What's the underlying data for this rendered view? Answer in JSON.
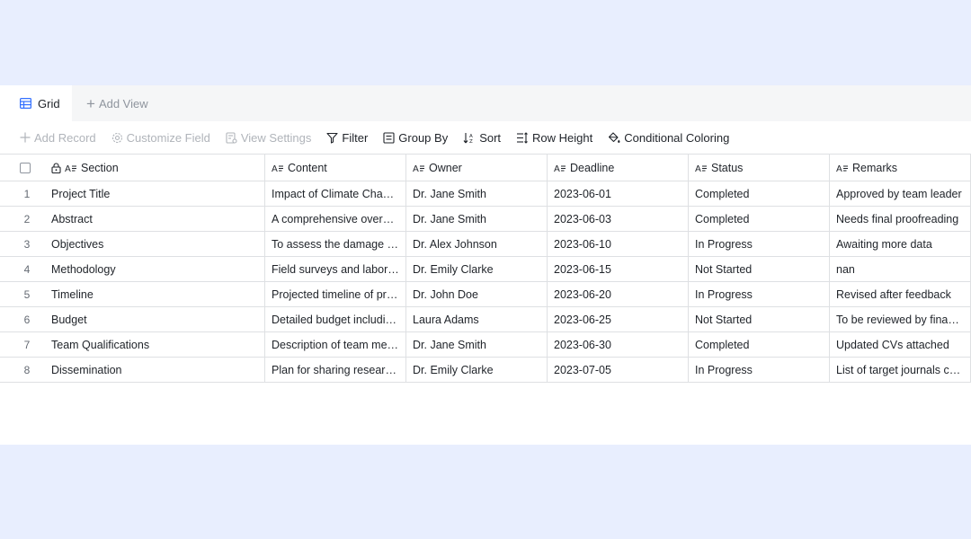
{
  "tabs": [
    {
      "label": "Grid"
    },
    {
      "label": "Add View"
    }
  ],
  "toolbar": {
    "add_record": "Add Record",
    "customize_field": "Customize Field",
    "view_settings": "View Settings",
    "filter": "Filter",
    "group_by": "Group By",
    "sort": "Sort",
    "row_height": "Row Height",
    "conditional_coloring": "Conditional Coloring"
  },
  "columns": [
    "Section",
    "Content",
    "Owner",
    "Deadline",
    "Status",
    "Remarks"
  ],
  "rows": [
    {
      "idx": "1",
      "section": "Project Title",
      "content": "Impact of Climate Change on Coastal Ecosystems",
      "owner": "Dr. Jane Smith",
      "deadline": "2023-06-01",
      "status": "Completed",
      "remarks": "Approved by team leader"
    },
    {
      "idx": "2",
      "section": "Abstract",
      "content": "A comprehensive overview of the research",
      "owner": "Dr. Jane Smith",
      "deadline": "2023-06-03",
      "status": "Completed",
      "remarks": "Needs final proofreading"
    },
    {
      "idx": "3",
      "section": "Objectives",
      "content": "To assess the damage to coastal habitats",
      "owner": "Dr. Alex Johnson",
      "deadline": "2023-06-10",
      "status": "In Progress",
      "remarks": "Awaiting more data"
    },
    {
      "idx": "4",
      "section": "Methodology",
      "content": "Field surveys and laboratory analysis",
      "owner": "Dr. Emily Clarke",
      "deadline": "2023-06-15",
      "status": "Not Started",
      "remarks": "nan"
    },
    {
      "idx": "5",
      "section": "Timeline",
      "content": "Projected timeline of project milestones",
      "owner": "Dr. John Doe",
      "deadline": "2023-06-20",
      "status": "In Progress",
      "remarks": "Revised after feedback"
    },
    {
      "idx": "6",
      "section": "Budget",
      "content": "Detailed budget including equipment costs",
      "owner": "Laura Adams",
      "deadline": "2023-06-25",
      "status": "Not Started",
      "remarks": "To be reviewed by finance team"
    },
    {
      "idx": "7",
      "section": "Team Qualifications",
      "content": "Description of team members' expertise",
      "owner": "Dr. Jane Smith",
      "deadline": "2023-06-30",
      "status": "Completed",
      "remarks": "Updated CVs attached"
    },
    {
      "idx": "8",
      "section": "Dissemination",
      "content": "Plan for sharing research findings",
      "owner": "Dr. Emily Clarke",
      "deadline": "2023-07-05",
      "status": "In Progress",
      "remarks": "List of target journals compiled"
    }
  ],
  "colors": {
    "page_bg": "#e8eefe",
    "accent": "#3370ff",
    "border": "#dee0e3",
    "disabled_text": "#b0b4ba"
  }
}
